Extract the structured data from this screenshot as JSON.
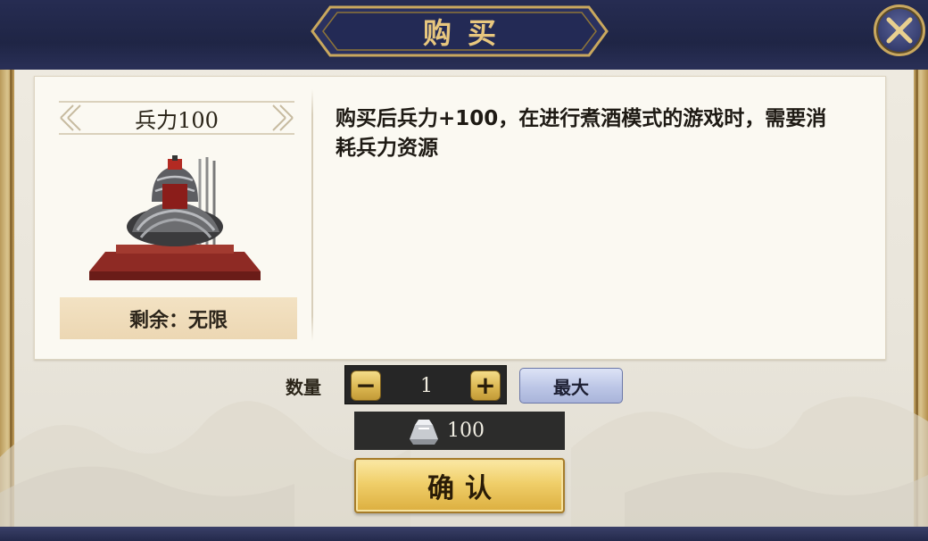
{
  "dialog": {
    "title": "购买",
    "close_icon": "close-icon"
  },
  "item": {
    "name": "兵力100",
    "image": "armor-helmet-display",
    "remaining": "剩余：无限",
    "description": "购买后兵力+100，在进行煮酒模式的游戏时，需要消耗兵力资源"
  },
  "quantity": {
    "label": "数量",
    "value": "1",
    "minus_label": "−",
    "plus_label": "+",
    "max_label": "最大"
  },
  "cost": {
    "icon": "silver-ingot-icon",
    "value": "100"
  },
  "confirm_label": "确认",
  "colors": {
    "header_bg": "#1f2545",
    "title_gold": "#e8c77e",
    "parchment": "#eeeae0",
    "confirm_gold": "#f0cf6a",
    "max_blue": "#bcc6e6"
  }
}
